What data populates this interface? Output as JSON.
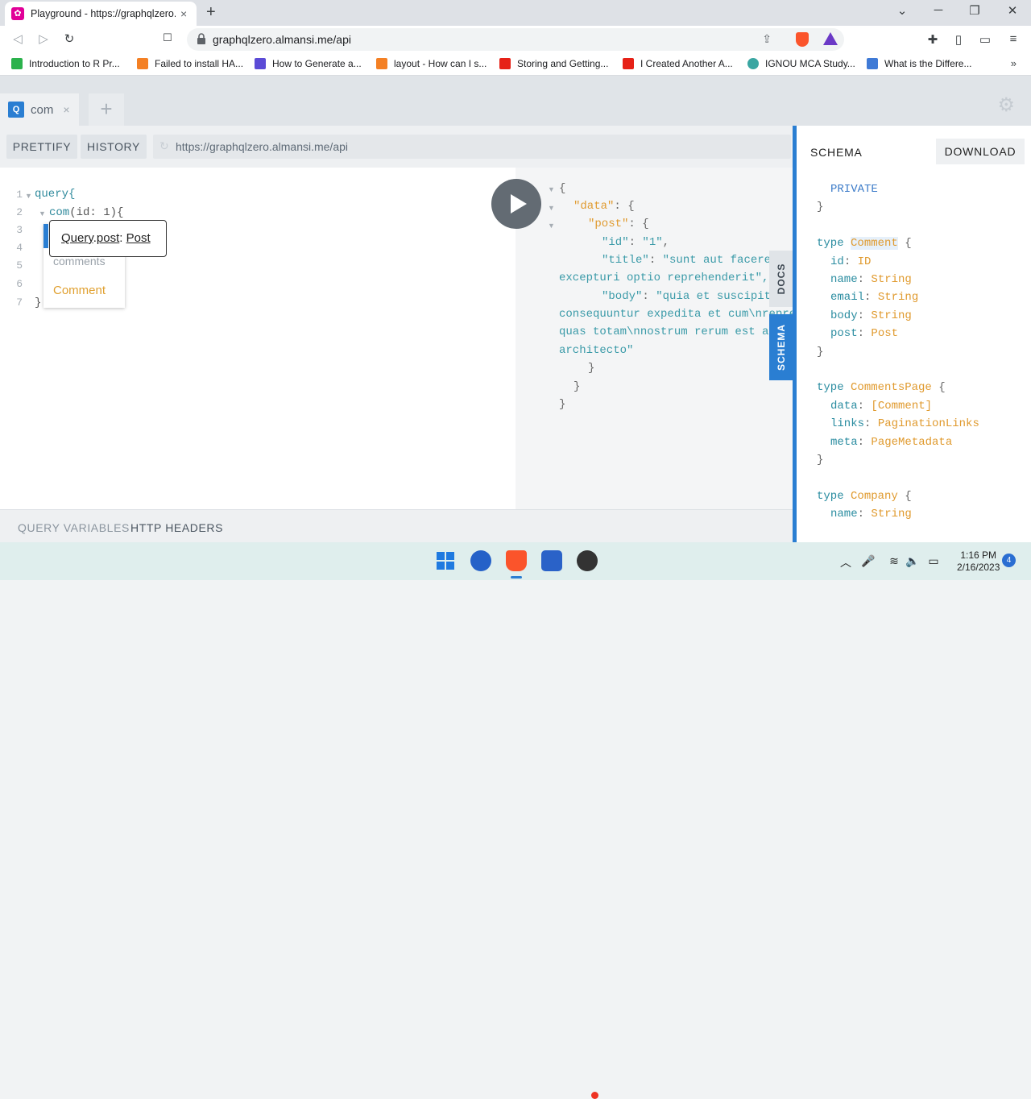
{
  "browser": {
    "tab_title": "Playground - https://graphqlzero.almansi.me/api",
    "tab_favicon": "graphql-icon",
    "url": "graphqlzero.almansi.me/api",
    "icons": {
      "back": "◁",
      "forward": "▷",
      "reload": "↻",
      "bookmark": "🔖",
      "share": "⇪",
      "extensions": "✚",
      "sidebar": "▯",
      "wallet": "▭",
      "menu": "≡",
      "new_tab": "+",
      "close": "×",
      "minimize": "⌄",
      "maximize": "─",
      "restore": "❐",
      "window_close": "✕"
    },
    "bookmarks": [
      {
        "label": "Introduction to R Pr...",
        "color": "#2bb24c"
      },
      {
        "label": "Failed to install HA...",
        "color": "#f48024"
      },
      {
        "label": "How to Generate a...",
        "color": "#5b4bd6"
      },
      {
        "label": "layout - How can I s...",
        "color": "#f48024"
      },
      {
        "label": "Storing and Getting...",
        "color": "#e62117"
      },
      {
        "label": "I Created Another A...",
        "color": "#e62117"
      },
      {
        "label": "IGNOU MCA Study...",
        "color": "#3aa6a2"
      },
      {
        "label": "What is the Differe...",
        "color": "#3f7ad6"
      }
    ],
    "bookmarks_more": "»"
  },
  "playground": {
    "tab_badge": "Q",
    "tab_name": "com",
    "tab_close": "×",
    "new_tab": "+",
    "settings_icon": "⚙",
    "prettify_label": "PRETTIFY",
    "history_label": "HISTORY",
    "endpoint": "https://graphqlzero.almansi.me/api",
    "editor": {
      "line_numbers": [
        "1",
        "2",
        "3",
        "4",
        "5",
        "6",
        "7"
      ],
      "line1": "query{",
      "line2_field": "com",
      "line2_args": "(id: 1){",
      "line7": "}"
    },
    "autocomplete": {
      "items": [
        "comments",
        "Comment"
      ],
      "tooltip_parts": [
        "Query",
        ".",
        "post",
        ": ",
        "Post"
      ]
    },
    "result": {
      "l1": "{",
      "l2_key": "\"data\"",
      "l2_rest": ": {",
      "l3_key": "\"post\"",
      "l3_rest": ": {",
      "l4_key": "\"id\"",
      "l4_val": "\"1\"",
      "l5_key": "\"title\"",
      "l5_val": "\"sunt aut facere repellat provident occaecati",
      "l6": "excepturi optio reprehenderit\",",
      "l7_key": "\"body\"",
      "l7_val": "\"quia et suscipit\\nsuscipit recusandae",
      "l8": "consequuntur expedita et cum\\nreprehenderit molestiae ut ut",
      "l9": "quas totam\\nnostrum rerum est autem sunt rem eveniet",
      "l10": "architecto\"",
      "l11": "}",
      "l12": "}",
      "l13": "}"
    },
    "docs_tab": "DOCS",
    "schema_tab": "SCHEMA",
    "query_variables": "QUERY VARIABLES",
    "http_headers": "HTTP HEADERS"
  },
  "schema": {
    "title": "SCHEMA",
    "download": "DOWNLOAD",
    "private": "PRIVATE",
    "closing_brace": "}",
    "type_kw": "type",
    "comment_type": "Comment",
    "comment_fields": [
      {
        "name": "id",
        "type": "ID"
      },
      {
        "name": "name",
        "type": "String"
      },
      {
        "name": "email",
        "type": "String"
      },
      {
        "name": "body",
        "type": "String"
      },
      {
        "name": "post",
        "type": "Post"
      }
    ],
    "comments_page_type": "CommentsPage",
    "comments_page_fields": [
      {
        "name": "data",
        "type": "[Comment]"
      },
      {
        "name": "links",
        "type": "PaginationLinks"
      },
      {
        "name": "meta",
        "type": "PageMetadata"
      }
    ],
    "company_type": "Company",
    "company_fields": [
      {
        "name": "name",
        "type": "String"
      }
    ]
  },
  "taskbar": {
    "time": "1:16 PM",
    "date": "2/16/2023",
    "notifications": "4",
    "tray_icons": {
      "chevron": "︿",
      "mic": "🎤",
      "wifi": "≋",
      "volume": "🔈",
      "battery": "▭"
    }
  }
}
